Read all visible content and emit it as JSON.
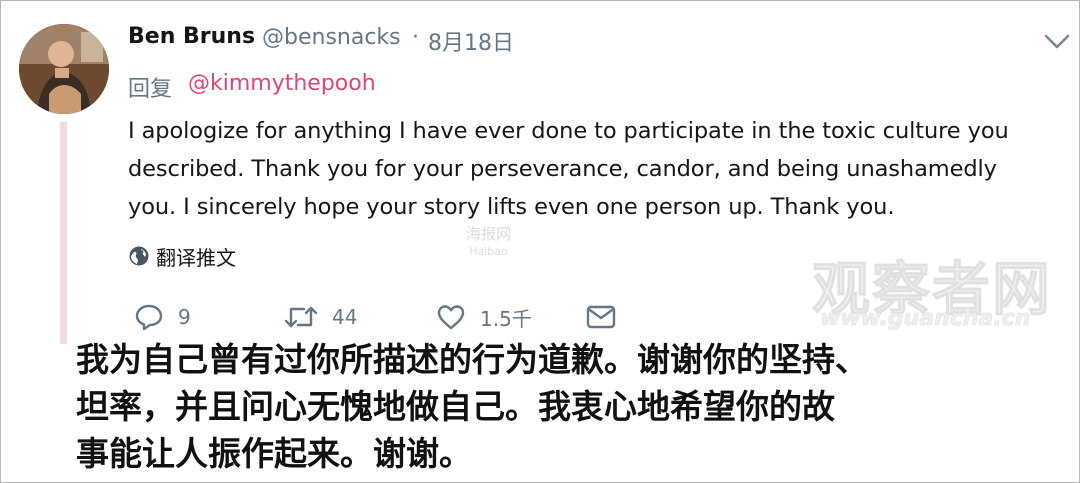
{
  "tweet": {
    "author_name": "Ben Bruns",
    "handle": "@bensnacks",
    "separator": "·",
    "date": "8月18日",
    "reply_label": "回复",
    "reply_to": "@kimmythepooh",
    "text_lines": [
      "I apologize for anything I have ever done to participate in the toxic culture you",
      "described. Thank you for your perseverance, candor, and being unashamedly",
      "you. I sincerely hope your story lifts even one person up. Thank you."
    ],
    "translate_label": "翻译推文",
    "actions": {
      "reply_count": "9",
      "retweet_count": "44",
      "like_count": "1.5千"
    }
  },
  "watermarks": {
    "small_main": "海报网",
    "small_sub": "Haibao",
    "brand": "观察者网",
    "url": "www.guancha.cn"
  },
  "caption_lines": [
    "我为自己曾有过你所描述的行为道歉。谢谢你的坚持、",
    "坦率，并且问心无愧地做自己。我衷心地希望你的故",
    "事能让人振作起来。谢谢。"
  ],
  "colors": {
    "text": "#14171a",
    "secondary": "#657786",
    "reply_link": "#e0245e",
    "thread_line": "#f3d9e0"
  },
  "icons": {
    "menu": "chevron-down-icon",
    "translate": "globe-icon",
    "reply": "speech-bubble-icon",
    "retweet": "retweet-icon",
    "like": "heart-icon",
    "dm": "envelope-icon"
  }
}
